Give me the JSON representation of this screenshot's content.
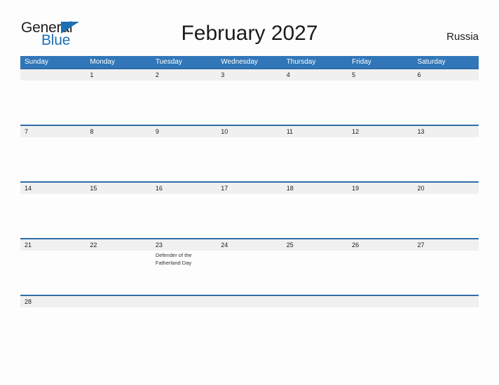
{
  "brand": {
    "name_part1": "General",
    "name_part2": "Blue",
    "accent_color": "#1f6fb5"
  },
  "header": {
    "title": "February 2027",
    "country": "Russia"
  },
  "theme": {
    "header_blue": "#3076b8",
    "rule_blue": "#2e6da8",
    "band_gray": "#f0f0f0",
    "page_background": "#fdfdfd"
  },
  "calendar": {
    "month": "February",
    "year": "2027",
    "weekdays": [
      "Sunday",
      "Monday",
      "Tuesday",
      "Wednesday",
      "Thursday",
      "Friday",
      "Saturday"
    ],
    "weeks": [
      [
        {
          "num": "",
          "event": ""
        },
        {
          "num": "1",
          "event": ""
        },
        {
          "num": "2",
          "event": ""
        },
        {
          "num": "3",
          "event": ""
        },
        {
          "num": "4",
          "event": ""
        },
        {
          "num": "5",
          "event": ""
        },
        {
          "num": "6",
          "event": ""
        }
      ],
      [
        {
          "num": "7",
          "event": ""
        },
        {
          "num": "8",
          "event": ""
        },
        {
          "num": "9",
          "event": ""
        },
        {
          "num": "10",
          "event": ""
        },
        {
          "num": "11",
          "event": ""
        },
        {
          "num": "12",
          "event": ""
        },
        {
          "num": "13",
          "event": ""
        }
      ],
      [
        {
          "num": "14",
          "event": ""
        },
        {
          "num": "15",
          "event": ""
        },
        {
          "num": "16",
          "event": ""
        },
        {
          "num": "17",
          "event": ""
        },
        {
          "num": "18",
          "event": ""
        },
        {
          "num": "19",
          "event": ""
        },
        {
          "num": "20",
          "event": ""
        }
      ],
      [
        {
          "num": "21",
          "event": ""
        },
        {
          "num": "22",
          "event": ""
        },
        {
          "num": "23",
          "event": "Defender of the Fatherland Day"
        },
        {
          "num": "24",
          "event": ""
        },
        {
          "num": "25",
          "event": ""
        },
        {
          "num": "26",
          "event": ""
        },
        {
          "num": "27",
          "event": ""
        }
      ],
      [
        {
          "num": "28",
          "event": ""
        },
        {
          "num": "",
          "event": ""
        },
        {
          "num": "",
          "event": ""
        },
        {
          "num": "",
          "event": ""
        },
        {
          "num": "",
          "event": ""
        },
        {
          "num": "",
          "event": ""
        },
        {
          "num": "",
          "event": ""
        }
      ]
    ]
  }
}
